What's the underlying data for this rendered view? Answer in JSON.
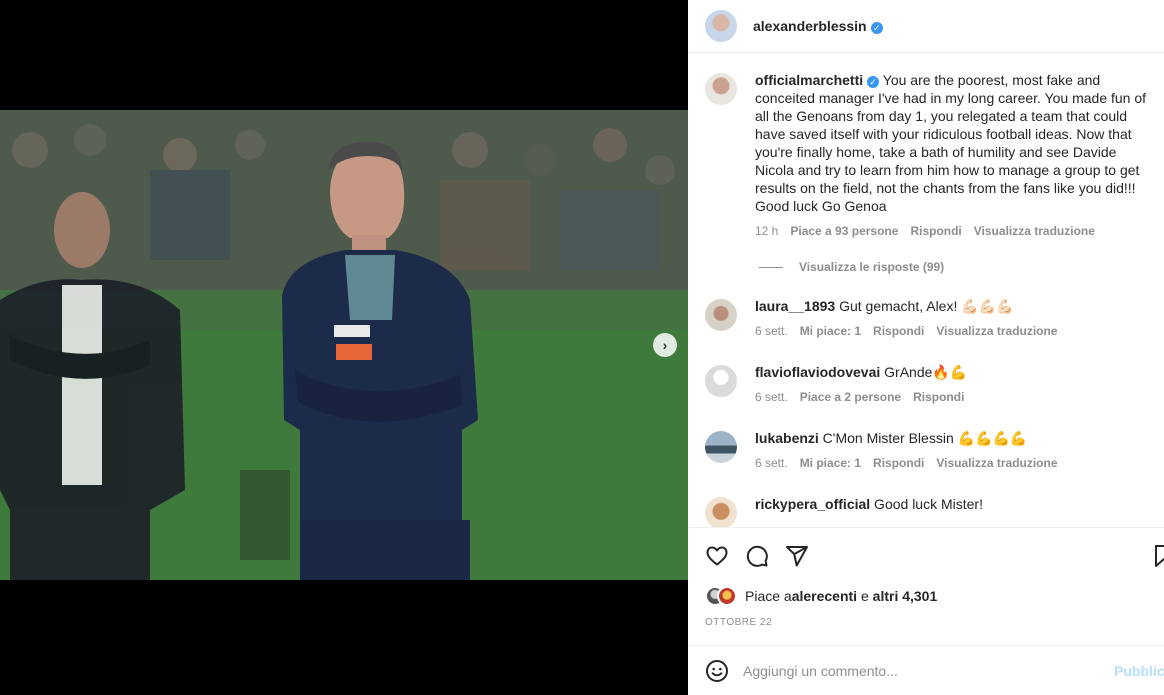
{
  "post": {
    "author": "alexanderblessin",
    "author_verified": true
  },
  "media": {
    "next_label": "›",
    "slides": 3,
    "active_slide": 0
  },
  "comments": [
    {
      "user": "officialmarchetti",
      "verified": true,
      "text": " You are the poorest, most fake and conceited manager I've had in my long career. You made fun of all the Genoans from day 1, you relegated a team that could have saved itself with your ridiculous football ideas. Now that you're finally home, take a bath of humility and see Davide Nicola and try to learn from him how to manage a group to get results on the field, not the chants from the fans like you did!!! Good luck Go Genoa",
      "time": "12 h",
      "likes": "Piace a 93 persone",
      "reply": "Rispondi",
      "translate": "Visualizza traduzione",
      "view_replies": "Visualizza le risposte (99)"
    },
    {
      "user": "laura__1893",
      "text": " Gut gemacht, Alex! 💪🏻💪🏻💪🏻",
      "time": "6 sett.",
      "likes": "Mi piace: 1",
      "reply": "Rispondi",
      "translate": "Visualizza traduzione"
    },
    {
      "user": "flavioflaviodovevai",
      "text": " GrAnde🔥💪",
      "time": "6 sett.",
      "likes": "Piace a 2 persone",
      "reply": "Rispondi"
    },
    {
      "user": "lukabenzi",
      "text": " C'Mon Mister Blessin 💪💪💪💪",
      "time": "6 sett.",
      "likes": "Mi piace: 1",
      "reply": "Rispondi",
      "translate": "Visualizza traduzione"
    },
    {
      "user": "rickypera_official",
      "text": " Good luck Mister!"
    }
  ],
  "actions": {
    "like_icon": "heart-icon",
    "comment_icon": "comment-icon",
    "share_icon": "paper-plane-icon",
    "save_icon": "bookmark-icon"
  },
  "likes_line": {
    "prefix": "Piace a ",
    "user": "alerecenti",
    "middle": " e ",
    "others": "altri 4,301"
  },
  "date": "OTTOBRE 22",
  "composer": {
    "emoji_icon": "smiley-icon",
    "placeholder": "Aggiungi un commento...",
    "publish": "Pubblica"
  },
  "colors": {
    "verified": "#3897f0",
    "muted": "#8e8e8e",
    "publish_disabled": "#b2dffc"
  }
}
